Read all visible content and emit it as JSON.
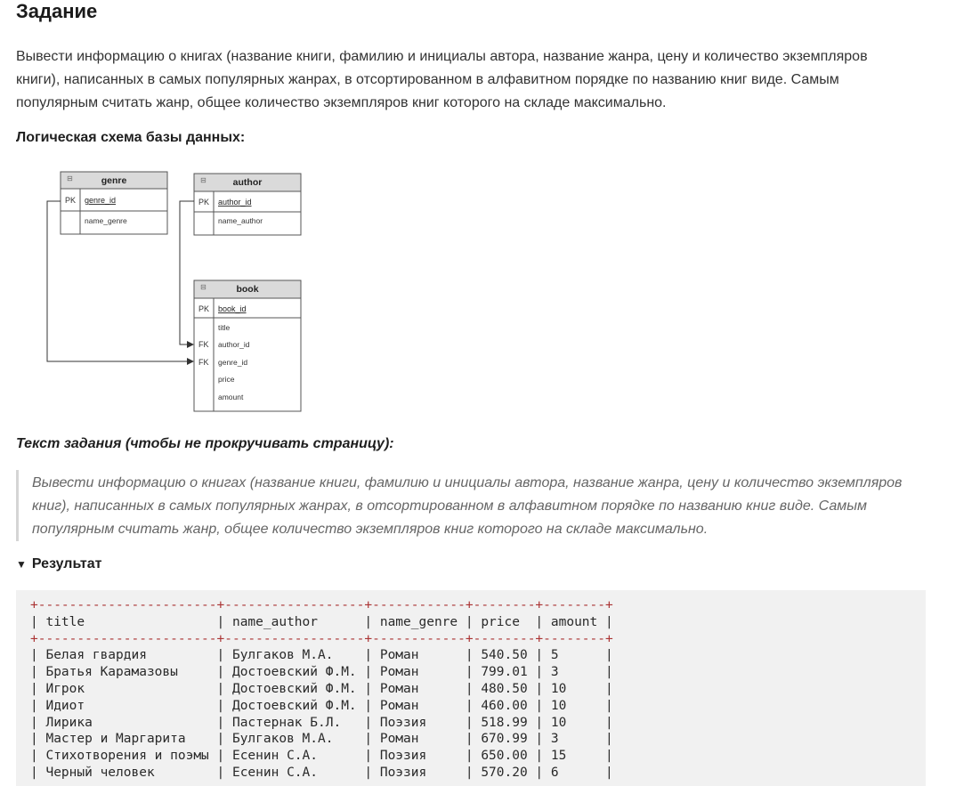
{
  "heading": "Задание",
  "description": "Вывести информацию о книгах (название книги, фамилию и инициалы автора, название жанра, цену и количество экземпляров книги), написанных в самых популярных жанрах, в отсортированном в алфавитном порядке по названию книг виде. Самым популярным считать жанр, общее количество экземпляров книг которого на складе максимально.",
  "schema_title": "Логическая схема базы данных:",
  "schema": {
    "genre": {
      "name": "genre",
      "pk_tag": "PK",
      "pk": "genre_id",
      "fields": [
        "name_genre"
      ]
    },
    "author": {
      "name": "author",
      "pk_tag": "PK",
      "pk": "author_id",
      "fields": [
        "name_author"
      ]
    },
    "book": {
      "name": "book",
      "pk_tag": "PK",
      "pk": "book_id",
      "fk_tag": "FK",
      "fields": [
        "title",
        "author_id",
        "genre_id",
        "price",
        "amount"
      ]
    },
    "collapse_glyph": "⊟"
  },
  "task_title": "Текст задания (чтобы не прокручивать страницу):",
  "task_quote": " Вывести информацию о книгах (название книги, фамилию и инициалы автора, название жанра, цену и количество экземпляров книг), написанных в самых популярных жанрах, в отсортированном в алфавитном порядке по названию книг виде. Самым популярным считать жанр, общее количество экземпляров книг которого на складе максимально.",
  "result": {
    "triangle": "▼",
    "label": "Результат",
    "columns": [
      "title",
      "name_author",
      "name_genre",
      "price",
      "amount"
    ],
    "rows": [
      [
        "Белая гвардия",
        "Булгаков М.А.",
        "Роман",
        "540.50",
        "5"
      ],
      [
        "Братья Карамазовы",
        "Достоевский Ф.М.",
        "Роман",
        "799.01",
        "3"
      ],
      [
        "Игрок",
        "Достоевский Ф.М.",
        "Роман",
        "480.50",
        "10"
      ],
      [
        "Идиот",
        "Достоевский Ф.М.",
        "Роман",
        "460.00",
        "10"
      ],
      [
        "Лирика",
        "Пастернак Б.Л.",
        "Поэзия",
        "518.99",
        "10"
      ],
      [
        "Мастер и Маргарита",
        "Булгаков М.А.",
        "Роман",
        "670.99",
        "3"
      ],
      [
        "Стихотворения и поэмы",
        "Есенин С.А.",
        "Поэзия",
        "650.00",
        "15"
      ],
      [
        "Черный человек",
        "Есенин С.А.",
        "Поэзия",
        "570.20",
        "6"
      ]
    ]
  }
}
